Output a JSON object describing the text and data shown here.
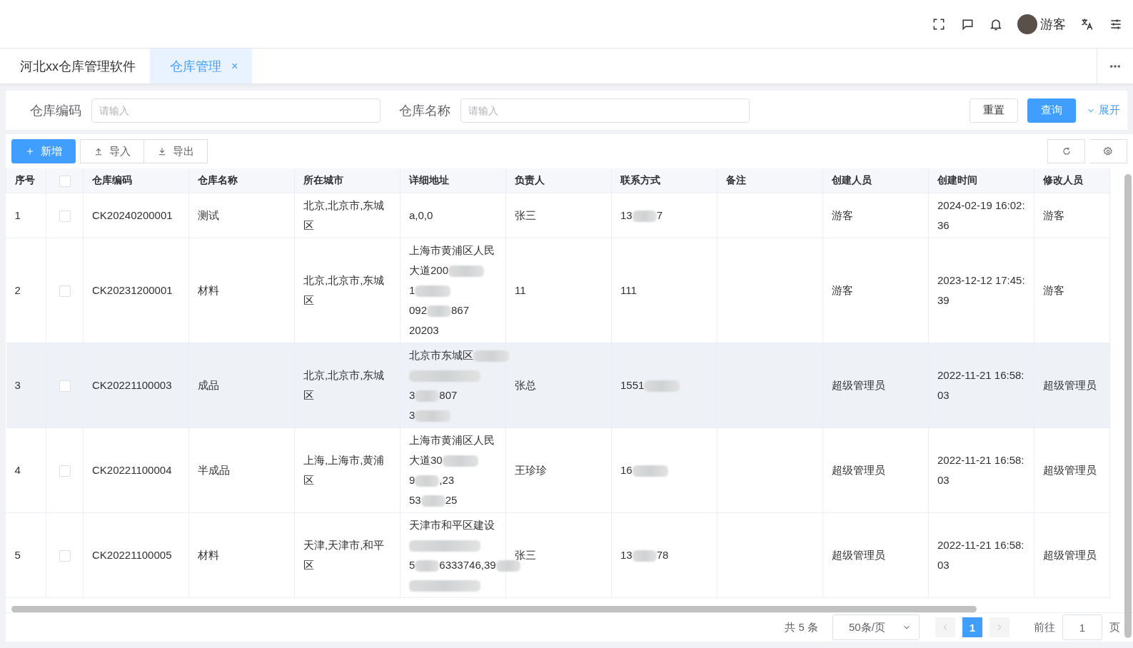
{
  "header": {
    "user_name": "游客"
  },
  "tabs": [
    {
      "label": "河北xx仓库管理软件",
      "selected": false,
      "closable": false
    },
    {
      "label": "仓库管理",
      "selected": true,
      "closable": true,
      "close_glyph": "×"
    }
  ],
  "search": {
    "fields": [
      {
        "label": "仓库编码",
        "placeholder": "请输入"
      },
      {
        "label": "仓库名称",
        "placeholder": "请输入"
      }
    ],
    "reset": "重置",
    "query": "查询",
    "expand": "展开"
  },
  "toolbar": {
    "buttons": [
      {
        "label": "新增",
        "kind": "primary"
      },
      {
        "label": "导入",
        "kind": "import"
      },
      {
        "label": "导出",
        "kind": "export"
      }
    ]
  },
  "table": {
    "columns": [
      "序号",
      "",
      "仓库编码",
      "仓库名称",
      "所在城市",
      "详细地址",
      "负责人",
      "联系方式",
      "备注",
      "创建人员",
      "创建时间",
      "修改人员"
    ],
    "header_checked": false,
    "rows": [
      {
        "index": "1",
        "checked": false,
        "highlighted": false,
        "code": "CK20240200001",
        "name": "测试",
        "city": "北京,北京市,东城区",
        "address": [
          [
            {
              "kind": "text",
              "text": "a,0,0"
            }
          ]
        ],
        "manager": "张三",
        "phone": [
          {
            "kind": "text",
            "text": "13"
          },
          {
            "kind": "blur"
          },
          {
            "kind": "text",
            "text": "7"
          }
        ],
        "creator": "游客",
        "created": "2024-02-19 16:02:36",
        "modifier": "游客"
      },
      {
        "index": "2",
        "checked": false,
        "highlighted": false,
        "code": "CK20231200001",
        "name": "材料",
        "city": "北京,北京市,东城区",
        "address": [
          [
            {
              "kind": "text",
              "text": "上海市黄浦区人民"
            }
          ],
          [
            {
              "kind": "text",
              "text": "大道200"
            },
            {
              "kind": "blur"
            }
          ],
          [
            {
              "kind": "text",
              "text": "1"
            },
            {
              "kind": "blur"
            }
          ],
          [
            {
              "kind": "text",
              "text": "092"
            },
            {
              "kind": "blur"
            },
            {
              "kind": "text",
              "text": "867"
            }
          ],
          [
            {
              "kind": "text",
              "text": "20203"
            }
          ]
        ],
        "manager": "11",
        "phone": [
          {
            "kind": "text",
            "text": "111"
          }
        ],
        "creator": "游客",
        "created": "2023-12-12 17:45:39",
        "modifier": "游客"
      },
      {
        "index": "3",
        "checked": false,
        "highlighted": true,
        "code": "CK20221100003",
        "name": "成品",
        "city": "北京,北京市,东城区",
        "address": [
          [
            {
              "kind": "text",
              "text": "北京市东城区"
            },
            {
              "kind": "blur"
            }
          ],
          [
            {
              "kind": "blur"
            }
          ],
          [
            {
              "kind": "text",
              "text": "3"
            },
            {
              "kind": "blur"
            },
            {
              "kind": "text",
              "text": "807"
            }
          ],
          [
            {
              "kind": "text",
              "text": "3"
            },
            {
              "kind": "blur"
            }
          ]
        ],
        "manager": "张总",
        "phone": [
          {
            "kind": "text",
            "text": "1551"
          },
          {
            "kind": "blur"
          }
        ],
        "creator": "超级管理员",
        "created": "2022-11-21 16:58:03",
        "modifier": "超级管理员"
      },
      {
        "index": "4",
        "checked": false,
        "highlighted": false,
        "code": "CK20221100004",
        "name": "半成品",
        "city": "上海,上海市,黄浦区",
        "address": [
          [
            {
              "kind": "text",
              "text": "上海市黄浦区人民"
            }
          ],
          [
            {
              "kind": "text",
              "text": "大道30"
            },
            {
              "kind": "blur"
            }
          ],
          [
            {
              "kind": "text",
              "text": "9"
            },
            {
              "kind": "blur"
            },
            {
              "kind": "text",
              "text": ",23"
            }
          ],
          [
            {
              "kind": "text",
              "text": "53"
            },
            {
              "kind": "blur"
            },
            {
              "kind": "text",
              "text": "25"
            }
          ]
        ],
        "manager": "王珍珍",
        "phone": [
          {
            "kind": "text",
            "text": "16"
          },
          {
            "kind": "blur"
          }
        ],
        "creator": "超级管理员",
        "created": "2022-11-21 16:58:03",
        "modifier": "超级管理员"
      },
      {
        "index": "5",
        "checked": false,
        "highlighted": false,
        "code": "CK20221100005",
        "name": "材料",
        "city": "天津,天津市,和平区",
        "address": [
          [
            {
              "kind": "text",
              "text": "天津市和平区建设"
            }
          ],
          [
            {
              "kind": "blur"
            }
          ],
          [
            {
              "kind": "text",
              "text": "5"
            },
            {
              "kind": "blur"
            },
            {
              "kind": "text",
              "text": "6333746,39"
            },
            {
              "kind": "blur"
            }
          ],
          [
            {
              "kind": "blur"
            }
          ]
        ],
        "manager": "张三",
        "phone": [
          {
            "kind": "text",
            "text": "13"
          },
          {
            "kind": "blur"
          },
          {
            "kind": "text",
            "text": "78"
          }
        ],
        "creator": "超级管理员",
        "created": "2022-11-21 16:58:03",
        "modifier": "超级管理员"
      }
    ]
  },
  "pagination": {
    "total": "共 5 条",
    "page_size": "50条/页",
    "pages": [
      {
        "label": "1",
        "selected": true
      }
    ],
    "goto_label": "前往",
    "goto_value": "1",
    "page_suffix": "页"
  }
}
